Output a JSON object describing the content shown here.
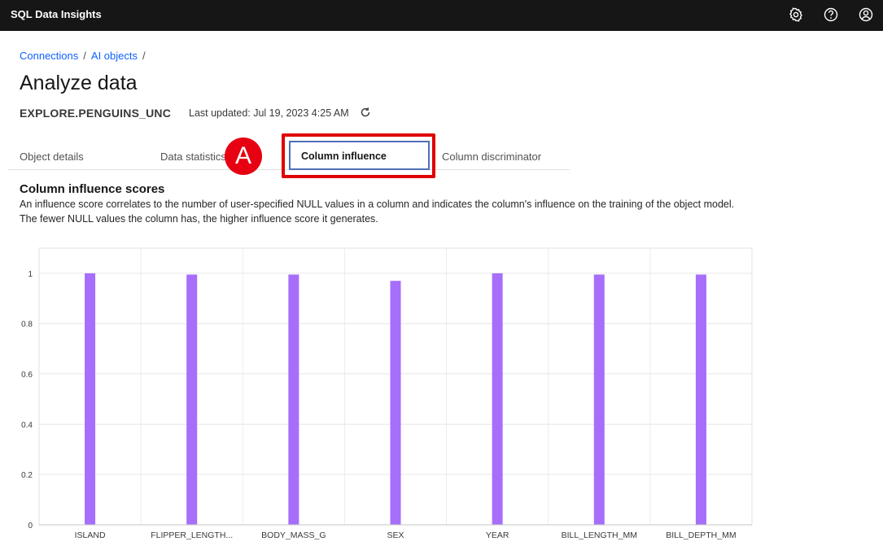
{
  "app": {
    "title": "SQL Data Insights"
  },
  "header_icons": [
    {
      "name": "settings-icon"
    },
    {
      "name": "help-icon"
    },
    {
      "name": "user-icon"
    }
  ],
  "breadcrumb": {
    "items": [
      "Connections",
      "AI objects"
    ],
    "separator": "/"
  },
  "page": {
    "title": "Analyze data",
    "object_name": "EXPLORE.PENGUINS_UNC",
    "last_updated": "Last updated: Jul 19, 2023 4:25 AM"
  },
  "tabs": [
    {
      "label": "Object details"
    },
    {
      "label": "Data statistics"
    },
    {
      "label": "Column influence",
      "active": true
    },
    {
      "label": "Column discriminator"
    }
  ],
  "annotation": {
    "marker": "A",
    "color": "#e60012"
  },
  "section": {
    "title": "Column influence scores",
    "description": "An influence score correlates to the number of user-specified NULL values in a column and indicates the column's influence on the training of the object model. The fewer NULL values the column has, the higher influence score it generates."
  },
  "chart_data": {
    "type": "bar",
    "categories": [
      "ISLAND",
      "FLIPPER_LENGTH...",
      "BODY_MASS_G",
      "SEX",
      "YEAR",
      "BILL_LENGTH_MM",
      "BILL_DEPTH_MM"
    ],
    "values": [
      1.0,
      0.995,
      0.995,
      0.97,
      1.0,
      0.995,
      0.995
    ],
    "ylim": [
      0,
      1.1
    ],
    "yticks": [
      0,
      0.2,
      0.4,
      0.6,
      0.8,
      1
    ],
    "ytick_labels": [
      "0",
      "0.2",
      "0.4",
      "0.6",
      "0.8",
      "1"
    ],
    "grid": true,
    "bar_color": "#a66efa"
  }
}
